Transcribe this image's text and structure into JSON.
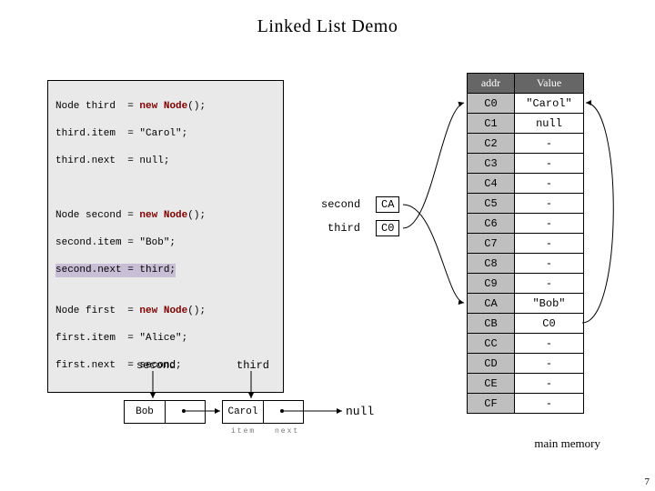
{
  "title": "Linked List Demo",
  "code": {
    "block1": [
      {
        "lhs": "Node third  ",
        "rhs": "new Node();",
        "kw": "new",
        "fn": "Node"
      },
      {
        "lhs": "third.item  ",
        "rhs": "\"Carol\";"
      },
      {
        "lhs": "third.next  ",
        "rhs": "null;"
      }
    ],
    "block2": [
      {
        "lhs": "Node second ",
        "rhs": "new Node();",
        "kw": "new",
        "fn": "Node"
      },
      {
        "lhs": "second.item ",
        "rhs": "\"Bob\";"
      },
      {
        "lhs": "second.next ",
        "rhs": "third;",
        "highlight": true
      }
    ],
    "block3": [
      {
        "lhs": "Node first  ",
        "rhs": "new Node();",
        "kw": "new",
        "fn": "Node"
      },
      {
        "lhs": "first.item  ",
        "rhs": "\"Alice\";"
      },
      {
        "lhs": "first.next  ",
        "rhs": "second;"
      }
    ]
  },
  "pointers": {
    "second_label": "second",
    "second_addr": "CA",
    "third_label": "third",
    "third_addr": "C0"
  },
  "memory": {
    "header": {
      "addr": "addr",
      "value": "Value"
    },
    "rows": [
      {
        "addr": "C0",
        "value": "\"Carol\""
      },
      {
        "addr": "C1",
        "value": "null"
      },
      {
        "addr": "C2",
        "value": "-"
      },
      {
        "addr": "C3",
        "value": "-"
      },
      {
        "addr": "C4",
        "value": "-"
      },
      {
        "addr": "C5",
        "value": "-"
      },
      {
        "addr": "C6",
        "value": "-"
      },
      {
        "addr": "C7",
        "value": "-"
      },
      {
        "addr": "C8",
        "value": "-"
      },
      {
        "addr": "C9",
        "value": "-"
      },
      {
        "addr": "CA",
        "value": "\"Bob\""
      },
      {
        "addr": "CB",
        "value": "C0"
      },
      {
        "addr": "CC",
        "value": "-"
      },
      {
        "addr": "CD",
        "value": "-"
      },
      {
        "addr": "CE",
        "value": "-"
      },
      {
        "addr": "CF",
        "value": "-"
      }
    ],
    "caption": "main memory"
  },
  "diagram": {
    "second_label": "second",
    "third_label": "third",
    "second_item": "Bob",
    "third_item": "Carol",
    "null": "null",
    "sub_item": "item",
    "sub_next": "next"
  },
  "page": "7"
}
